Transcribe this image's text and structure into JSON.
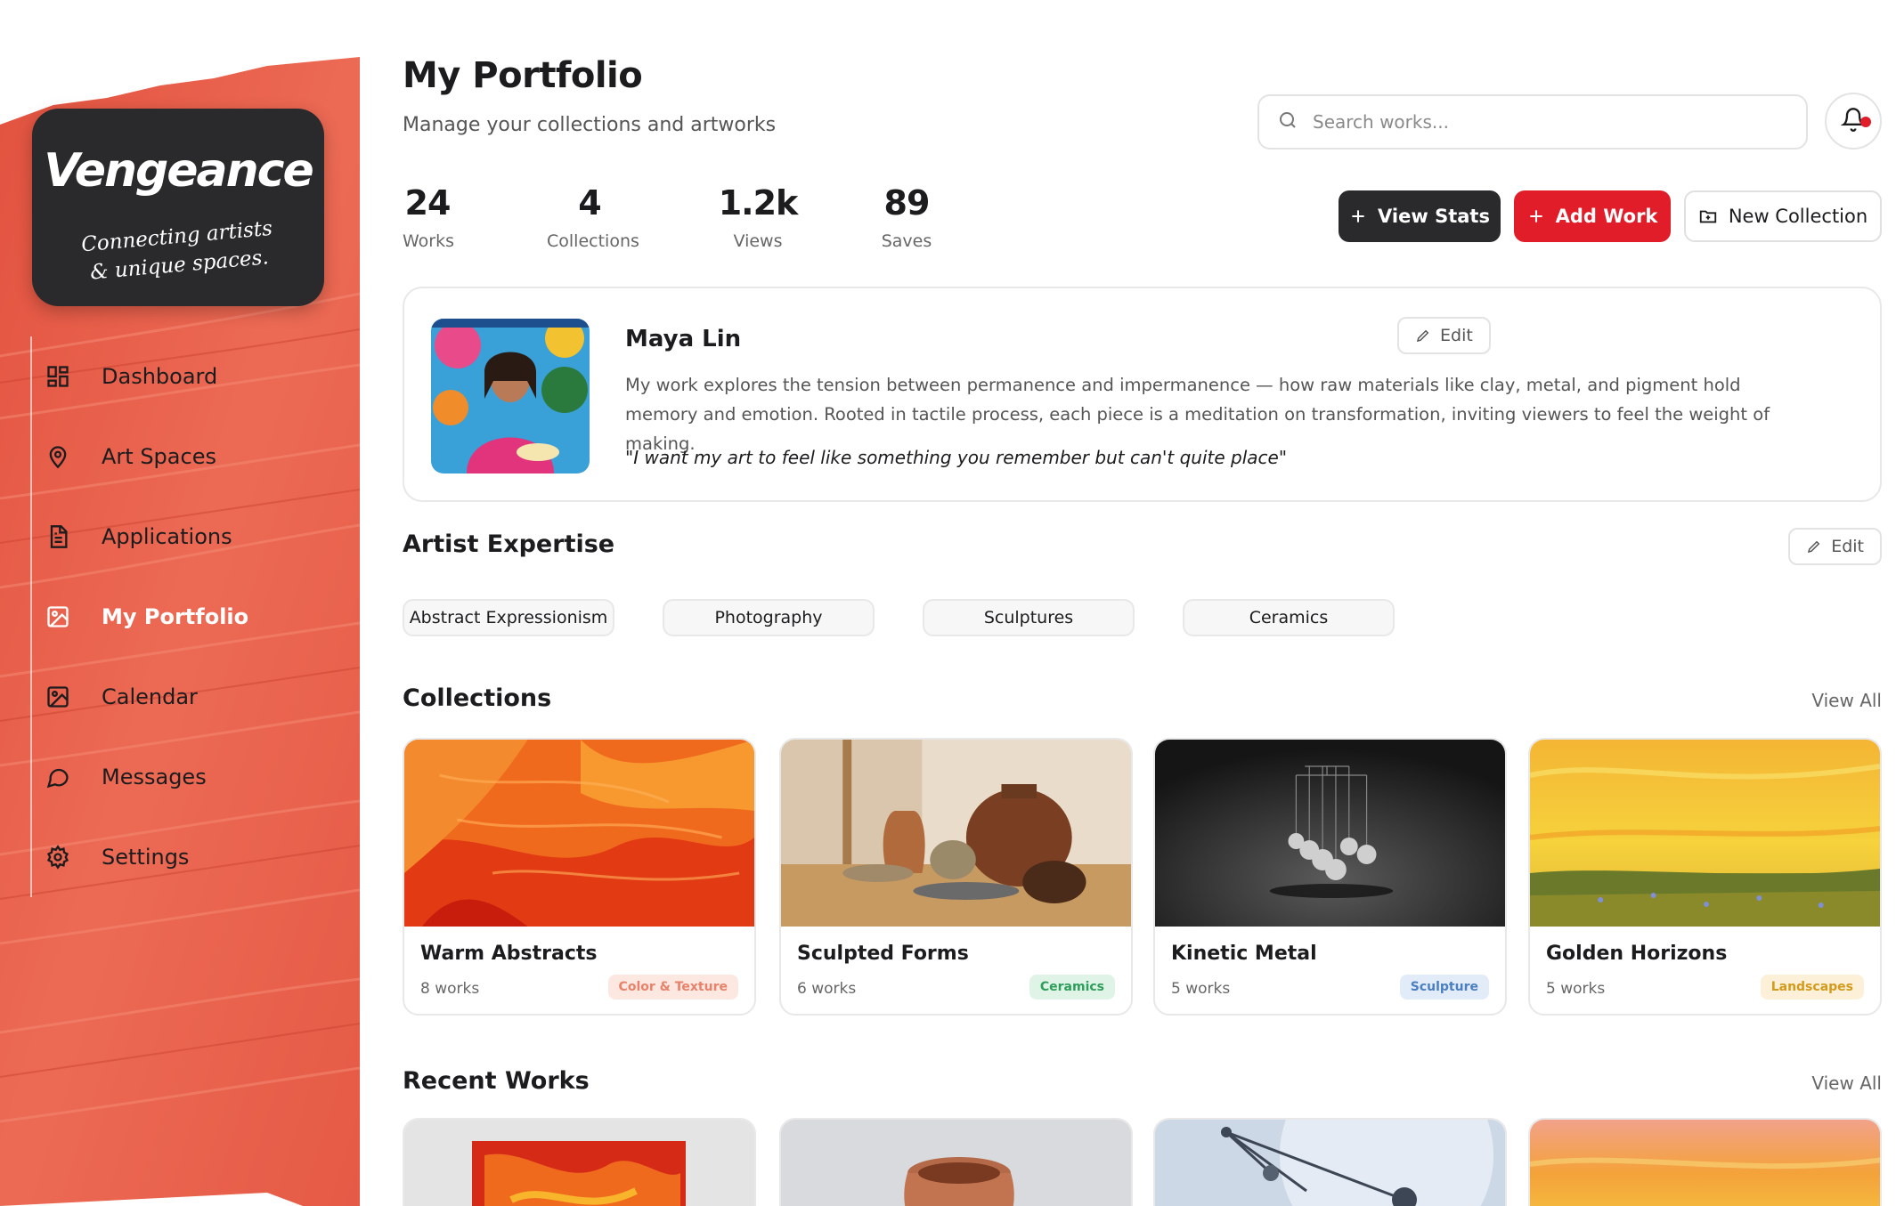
{
  "app": {
    "name": "Vengeance",
    "tagline_line1": "Connecting artists",
    "tagline_line2": "& unique spaces."
  },
  "sidebar": {
    "items": [
      {
        "label": "Dashboard",
        "icon": "dashboard-icon",
        "active": false
      },
      {
        "label": "Art Spaces",
        "icon": "map-pin-icon",
        "active": false
      },
      {
        "label": "Applications",
        "icon": "document-icon",
        "active": false
      },
      {
        "label": "My Portfolio",
        "icon": "image-icon",
        "active": true
      },
      {
        "label": "Calendar",
        "icon": "image-icon",
        "active": false
      },
      {
        "label": "Messages",
        "icon": "chat-bubble-icon",
        "active": false
      },
      {
        "label": "Settings",
        "icon": "gear-icon",
        "active": false
      }
    ]
  },
  "header": {
    "title": "My Portfolio",
    "subtitle": "Manage your collections and artworks",
    "search_placeholder": "Search works..."
  },
  "stats": [
    {
      "value": "24",
      "label": "Works"
    },
    {
      "value": "4",
      "label": "Collections"
    },
    {
      "value": "1.2k",
      "label": "Views"
    },
    {
      "value": "89",
      "label": "Saves"
    }
  ],
  "actions": {
    "view_stats": "View Stats",
    "add_work": "Add Work",
    "new_collection": "New Collection"
  },
  "profile": {
    "name": "Maya Lin",
    "bio": "My work explores the tension between permanence and impermanence — how raw materials like clay, metal, and pigment hold memory and emotion. Rooted in tactile process, each piece is a meditation on transformation, inviting viewers to feel the weight of making.",
    "quote": "\"I want my art to feel like something you remember but can't quite place\"",
    "edit_label": "Edit"
  },
  "expertise": {
    "title": "Artist Expertise",
    "edit_label": "Edit",
    "chips": [
      "Abstract Expressionism",
      "Photography",
      "Sculptures",
      "Ceramics"
    ]
  },
  "collections": {
    "title": "Collections",
    "view_all": "View All",
    "items": [
      {
        "name": "Warm Abstracts",
        "count": "8 works",
        "tag": "Color & Texture",
        "tag_color": "#e8826a",
        "tag_bg": "#fde8e1"
      },
      {
        "name": "Sculpted Forms",
        "count": "6 works",
        "tag": "Ceramics",
        "tag_color": "#2f9e5b",
        "tag_bg": "#dff4e6"
      },
      {
        "name": "Kinetic Metal",
        "count": "5 works",
        "tag": "Sculpture",
        "tag_color": "#4a7fc1",
        "tag_bg": "#e2ecf9"
      },
      {
        "name": "Golden Horizons",
        "count": "5 works",
        "tag": "Landscapes",
        "tag_color": "#d49a1c",
        "tag_bg": "#fcf1d8"
      }
    ]
  },
  "recent": {
    "title": "Recent Works",
    "view_all": "View All"
  },
  "colors": {
    "brand_red": "#e11d2a",
    "sidebar_paint": "#e8604c",
    "dark": "#2a2a2c"
  }
}
